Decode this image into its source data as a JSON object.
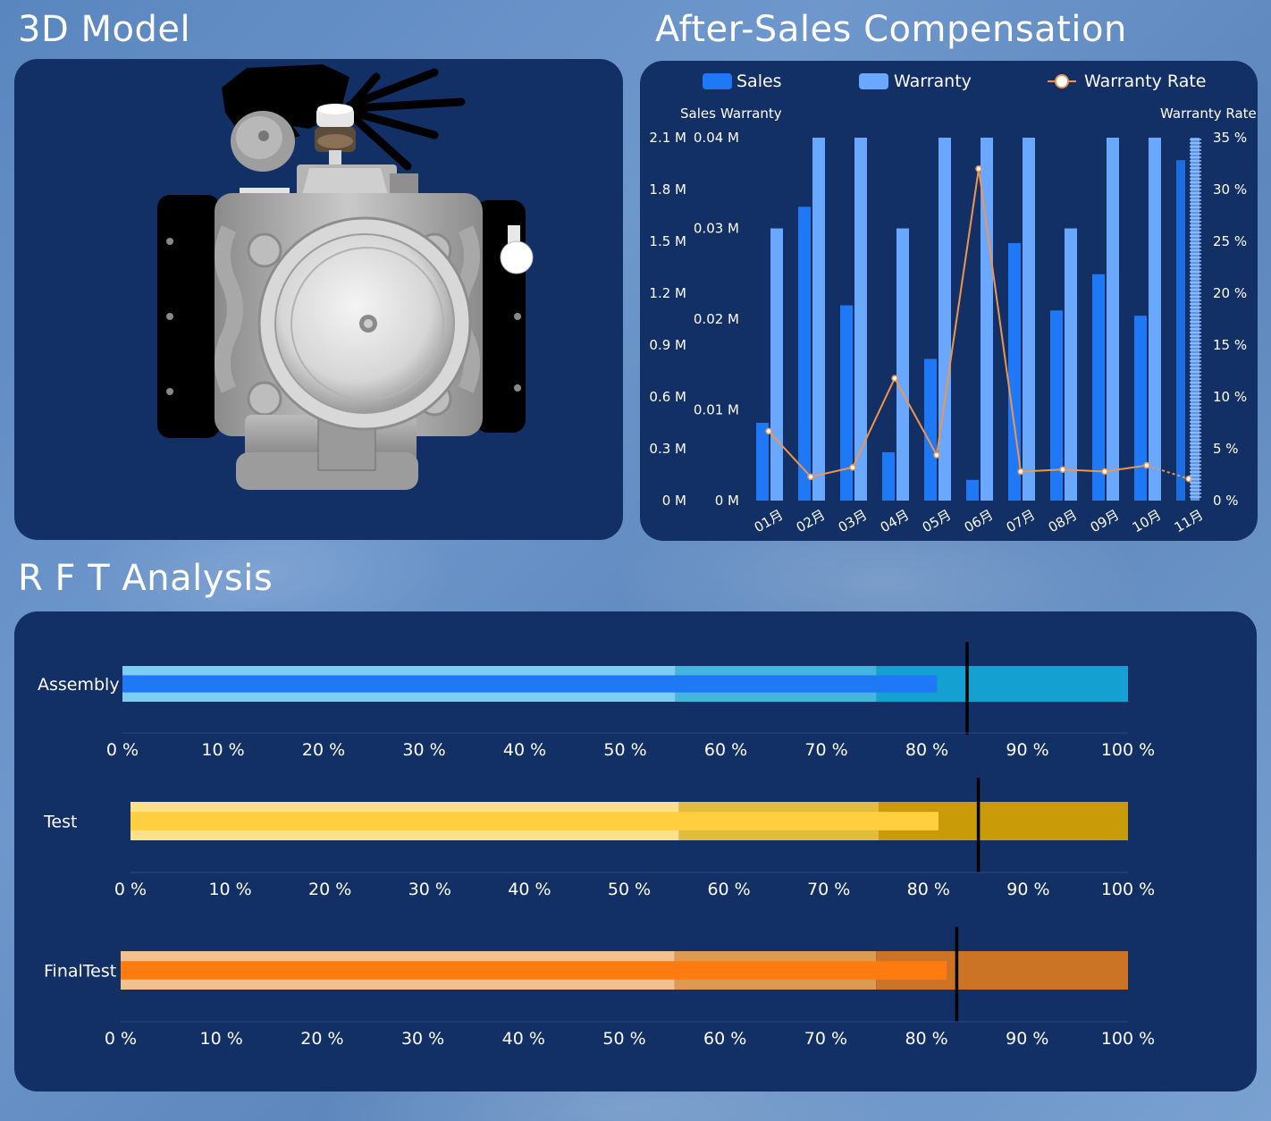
{
  "titles": {
    "model": "3D Model",
    "aftersales": "After-Sales Compensation",
    "rft": "R F T Analysis"
  },
  "colors": {
    "panel": "#122f66",
    "sales": "#1f78f5",
    "warranty": "#6aa8ff",
    "rate": "#f0954c"
  },
  "chart_data": [
    {
      "type": "bar",
      "title": "After-Sales Compensation",
      "categories": [
        "01月",
        "02月",
        "03月",
        "04月",
        "05月",
        "06月",
        "07月",
        "08月",
        "09月",
        "10月",
        "11月"
      ],
      "legend": {
        "sales": "Sales",
        "warranty": "Warranty",
        "rate": "Warranty Rate"
      },
      "axis_titles": {
        "sales": "Sales",
        "warranty": "Warranty",
        "rate": "Warranty Rate"
      },
      "axes": {
        "sales": {
          "min": 0,
          "max": 2.1,
          "ticks": [
            "0 M",
            "0.3 M",
            "0.6 M",
            "0.9 M",
            "1.2 M",
            "1.5 M",
            "1.8 M",
            "2.1 M"
          ]
        },
        "warranty": {
          "min": 0,
          "max": 0.04,
          "ticks": [
            "0 M",
            "0.01 M",
            "0.02 M",
            "0.03 M",
            "0.04 M"
          ]
        },
        "rate": {
          "min": 0,
          "max": 35,
          "ticks": [
            "0 %",
            "5 %",
            "10 %",
            "15 %",
            "20 %",
            "25 %",
            "30 %",
            "35 %"
          ]
        }
      },
      "series": [
        {
          "name": "Sales",
          "axis": "sales",
          "unit": "M",
          "values": [
            0.45,
            1.7,
            1.13,
            0.28,
            0.82,
            0.12,
            1.49,
            1.1,
            1.31,
            1.07,
            1.97
          ]
        },
        {
          "name": "Warranty",
          "axis": "warranty",
          "unit": "M",
          "values": [
            0.03,
            0.04,
            0.04,
            0.03,
            0.04,
            0.04,
            0.04,
            0.03,
            0.04,
            0.04,
            0.04
          ]
        },
        {
          "name": "Warranty Rate",
          "axis": "rate",
          "unit": "%",
          "type": "line",
          "values": [
            6.7,
            2.3,
            3.2,
            11.8,
            4.4,
            32.0,
            2.8,
            3.0,
            2.8,
            3.4,
            2.1
          ]
        }
      ],
      "legend_position": "top"
    },
    {
      "type": "bullet",
      "title": "R F T Analysis",
      "axis": {
        "min": 0,
        "max": 100,
        "ticks": [
          "0 %",
          "10 %",
          "20 %",
          "30 %",
          "40 %",
          "50 %",
          "60 %",
          "70 %",
          "80 %",
          "90 %",
          "100 %"
        ]
      },
      "bands": [
        55,
        75,
        100
      ],
      "rows": [
        {
          "label": "Assembly",
          "value": 81,
          "target": 84,
          "color": "#1f78f5",
          "band_colors": [
            "#7ccff2",
            "#44b6dd",
            "#14a0d0"
          ]
        },
        {
          "label": "Test",
          "value": 81,
          "target": 85,
          "color": "#ffcf40",
          "band_colors": [
            "#fde08a",
            "#e1bd3e",
            "#c99b08"
          ]
        },
        {
          "label": "FinalTest",
          "value": 82,
          "target": 83,
          "color": "#ff7b10",
          "band_colors": [
            "#f2c18e",
            "#dd9a51",
            "#cc7426"
          ]
        }
      ]
    }
  ]
}
